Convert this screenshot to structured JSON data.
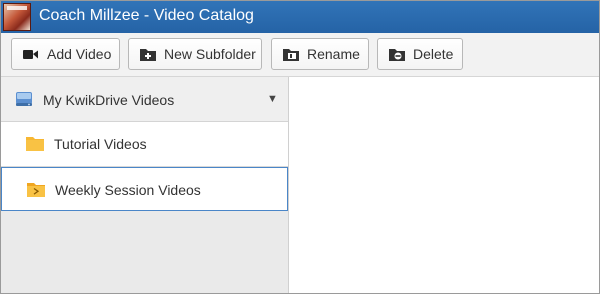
{
  "window": {
    "title": "Coach Millzee - Video Catalog"
  },
  "toolbar": {
    "buttons": [
      {
        "label": "Add Video",
        "icon": "video-camera-icon"
      },
      {
        "label": "New Subfolder",
        "icon": "new-folder-icon"
      },
      {
        "label": "Rename",
        "icon": "rename-folder-icon"
      },
      {
        "label": "Delete",
        "icon": "delete-folder-icon"
      }
    ]
  },
  "sidebar": {
    "root": {
      "label": "My KwikDrive Videos",
      "icon": "drive-icon",
      "expanded": true
    },
    "folders": [
      {
        "label": "Tutorial Videos",
        "icon": "folder-icon",
        "selected": false
      },
      {
        "label": "Weekly Session Videos",
        "icon": "folder-open-icon",
        "selected": true
      }
    ]
  },
  "colors": {
    "titlebar": "#2b6cb0",
    "folder": "#f7b733",
    "selection_border": "#4a86c8"
  }
}
